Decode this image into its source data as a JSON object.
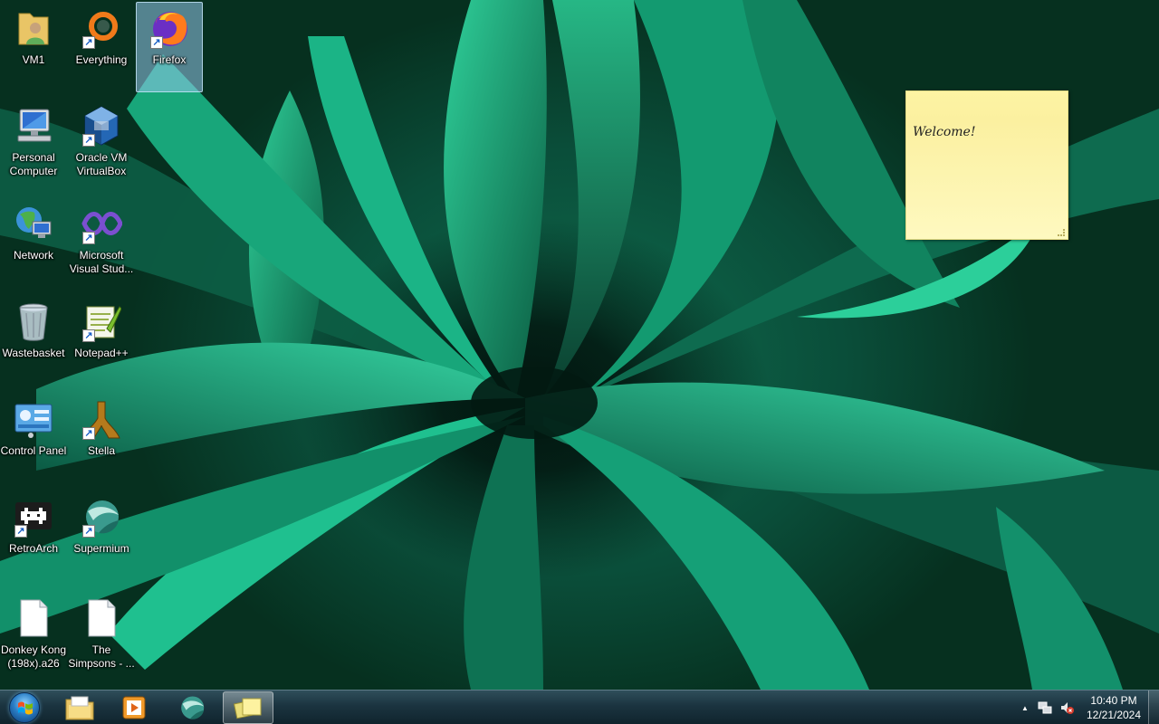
{
  "desktop": {
    "icons": [
      {
        "label": "VM1",
        "icon": "user-folder-icon"
      },
      {
        "label": "Everything",
        "icon": "everything-search-icon"
      },
      {
        "label": "Firefox",
        "icon": "firefox-icon"
      },
      {
        "label": "Personal Computer",
        "icon": "computer-icon"
      },
      {
        "label": "Oracle VM VirtualBox",
        "icon": "virtualbox-icon"
      },
      {
        "label": "Network",
        "icon": "network-icon"
      },
      {
        "label": "Microsoft Visual Stud...",
        "icon": "visual-studio-icon"
      },
      {
        "label": "Wastebasket",
        "icon": "recycle-bin-icon"
      },
      {
        "label": "Notepad++",
        "icon": "notepadpp-icon"
      },
      {
        "label": "Control Panel",
        "icon": "control-panel-icon"
      },
      {
        "label": "Stella",
        "icon": "stella-icon"
      },
      {
        "label": "RetroArch",
        "icon": "retroarch-icon"
      },
      {
        "label": "Supermium",
        "icon": "supermium-icon"
      },
      {
        "label": "Donkey Kong (198x).a26",
        "icon": "file-icon"
      },
      {
        "label": "The Simpsons - ...",
        "icon": "file-icon"
      }
    ],
    "selected": "Firefox"
  },
  "sticky_note": {
    "text": "Welcome!"
  },
  "taskbar": {
    "pinned": [
      {
        "name": "File Explorer",
        "icon": "file-explorer-icon"
      },
      {
        "name": "Media Player",
        "icon": "media-player-icon"
      },
      {
        "name": "Supermium",
        "icon": "supermium-icon"
      },
      {
        "name": "Sticky Notes",
        "icon": "sticky-notes-icon"
      }
    ],
    "active": "Sticky Notes"
  },
  "tray": {
    "time": "10:40 PM",
    "date": "12/21/2024",
    "overflow_glyph": "▲"
  },
  "colors": {
    "taskbar": "#1b3440",
    "selection": "#96c8eb",
    "sticky": "#fdf4a3"
  }
}
